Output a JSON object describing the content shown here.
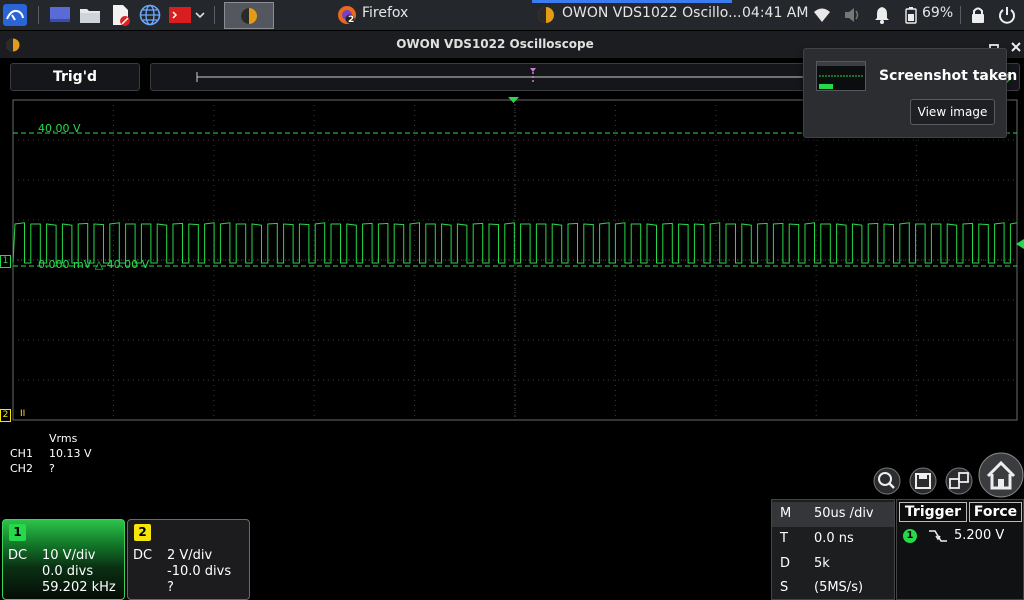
{
  "taskbar": {
    "firefox_label": "Firefox",
    "firefox_badge": "2",
    "active_window_label": "OWON VDS1022 Oscillo...",
    "clock": "04:41 AM",
    "battery": "69%"
  },
  "window": {
    "title": "OWON VDS1022 Oscilloscope"
  },
  "status": {
    "trigger_state": "Trig'd"
  },
  "scope": {
    "ref_level_label": "40.00 V",
    "cursor_label": "0.000 mV △ 40.00 V",
    "ch1_marker": "1",
    "ch2_marker": "2",
    "ch2_trace_text": "II"
  },
  "measurements": {
    "header": "Vrms",
    "rows": [
      {
        "channel": "CH1",
        "value": "10.13 V"
      },
      {
        "channel": "CH2",
        "value": "?"
      }
    ]
  },
  "channels": [
    {
      "number": "1",
      "coupling": "DC",
      "volts_div": "10 V/div",
      "offset": "0.0 divs",
      "frequency": "59.202 kHz",
      "color": "#27d94a"
    },
    {
      "number": "2",
      "coupling": "DC",
      "volts_div": "2 V/div",
      "offset": "-10.0 divs",
      "frequency": "?",
      "color": "#f4e60b"
    }
  ],
  "horizontal": {
    "rows": [
      {
        "key": "M",
        "value": "50us /div"
      },
      {
        "key": "T",
        "value": "0.0 ns"
      },
      {
        "key": "D",
        "value": "5k"
      },
      {
        "key": "S",
        "value": "(5MS/s)"
      }
    ]
  },
  "trigger": {
    "trigger_label": "Trigger",
    "force_label": "Force",
    "channel": "1",
    "level": "5.200 V"
  },
  "notification": {
    "title": "Screenshot taken",
    "button": "View image"
  },
  "colors": {
    "trace": "#27d94a",
    "grid": "#3a3a3a",
    "ch2": "#f4e60b",
    "accent": "#3d7cf0"
  },
  "icons": {
    "tool_buttons": [
      "zoom-home-icon",
      "save-icon",
      "swap-window-icon",
      "home-icon"
    ]
  }
}
